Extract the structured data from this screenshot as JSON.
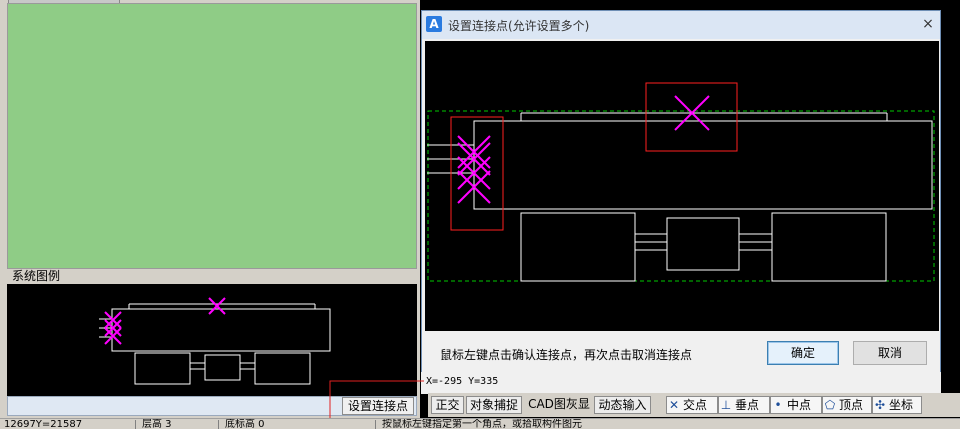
{
  "legend": {
    "title": "系统图例"
  },
  "legend_footer": {
    "button_label": "设置连接点"
  },
  "dialog": {
    "title": "设置连接点(允许设置多个)",
    "app_icon": "A",
    "close_glyph": "×",
    "hint": "鼠标左键点击确认连接点，再次点击取消连接点",
    "ok_label": "确定",
    "cancel_label": "取消"
  },
  "coords": "X=-295  Y=335",
  "snap_toolbar": {
    "items": [
      {
        "label": "正交"
      },
      {
        "label": "对象捕捉"
      },
      {
        "label": "CAD图灰显"
      },
      {
        "label": "动态输入"
      },
      {
        "label": "交点",
        "icon": "intersection-icon"
      },
      {
        "label": "垂点",
        "icon": "perpendicular-icon"
      },
      {
        "label": "中点",
        "icon": "midpoint-icon"
      },
      {
        "label": "顶点",
        "icon": "vertex-icon"
      },
      {
        "label": "坐标",
        "icon": "coordinate-icon"
      }
    ]
  },
  "status_bar": {
    "coord_value": "12697Y=21587",
    "floor_height_label": "层高 3",
    "base_height_label": "底标高 0",
    "prompt": "按鼠标左键指定第一个角点，或拾取构件图元"
  },
  "colors": {
    "green_area": "#8fcc86",
    "cad_lines": "#ffffff",
    "connection_marks": "#ff00ff",
    "highlight_box": "#ff2020",
    "dashed_bound": "#00c800"
  }
}
